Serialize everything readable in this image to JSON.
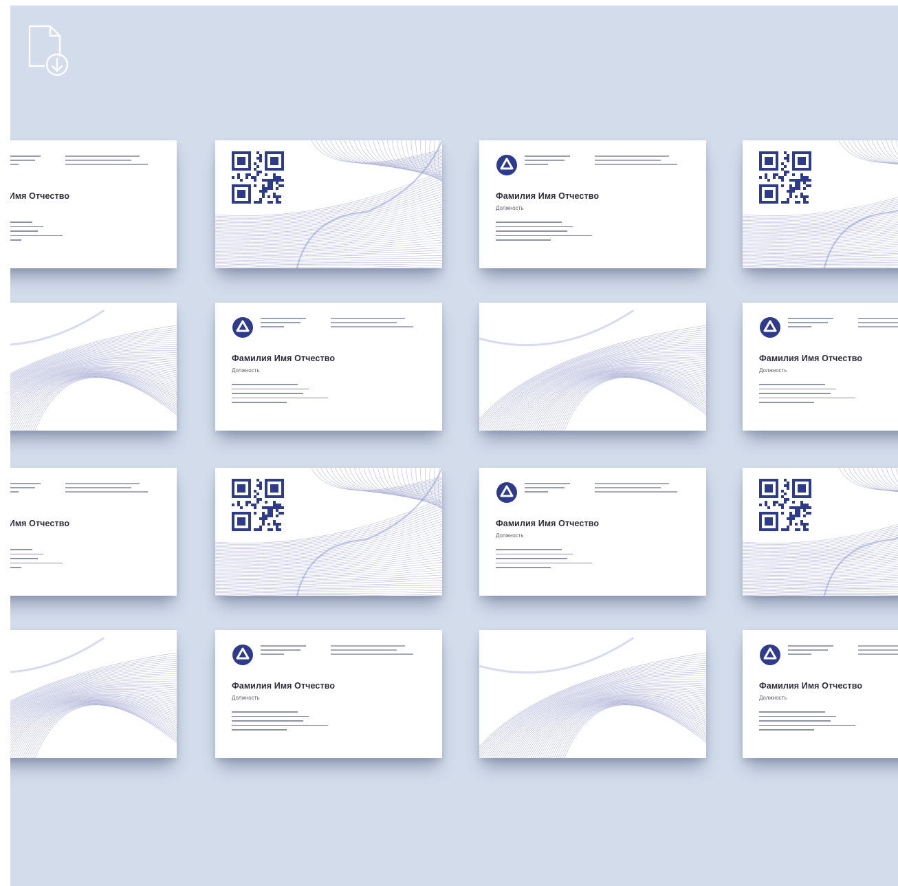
{
  "colors": {
    "background": "#d2dceb",
    "card": "#ffffff",
    "brand_blue": "#2e3a8c",
    "line_lilac": "#a9aed4",
    "icon_white": "#ffffff"
  },
  "toolbar": {
    "download_icon": "file-download-icon"
  },
  "card_front": {
    "name": "Фамилия Имя Отчество",
    "position": "Должность"
  },
  "mockup": {
    "rows": 4,
    "columns": 4,
    "row_patterns": [
      [
        "front",
        "qr",
        "front",
        "qr"
      ],
      [
        "back",
        "front",
        "back",
        "front"
      ],
      [
        "front",
        "qr",
        "front",
        "qr"
      ],
      [
        "back",
        "front",
        "back",
        "front"
      ]
    ]
  }
}
